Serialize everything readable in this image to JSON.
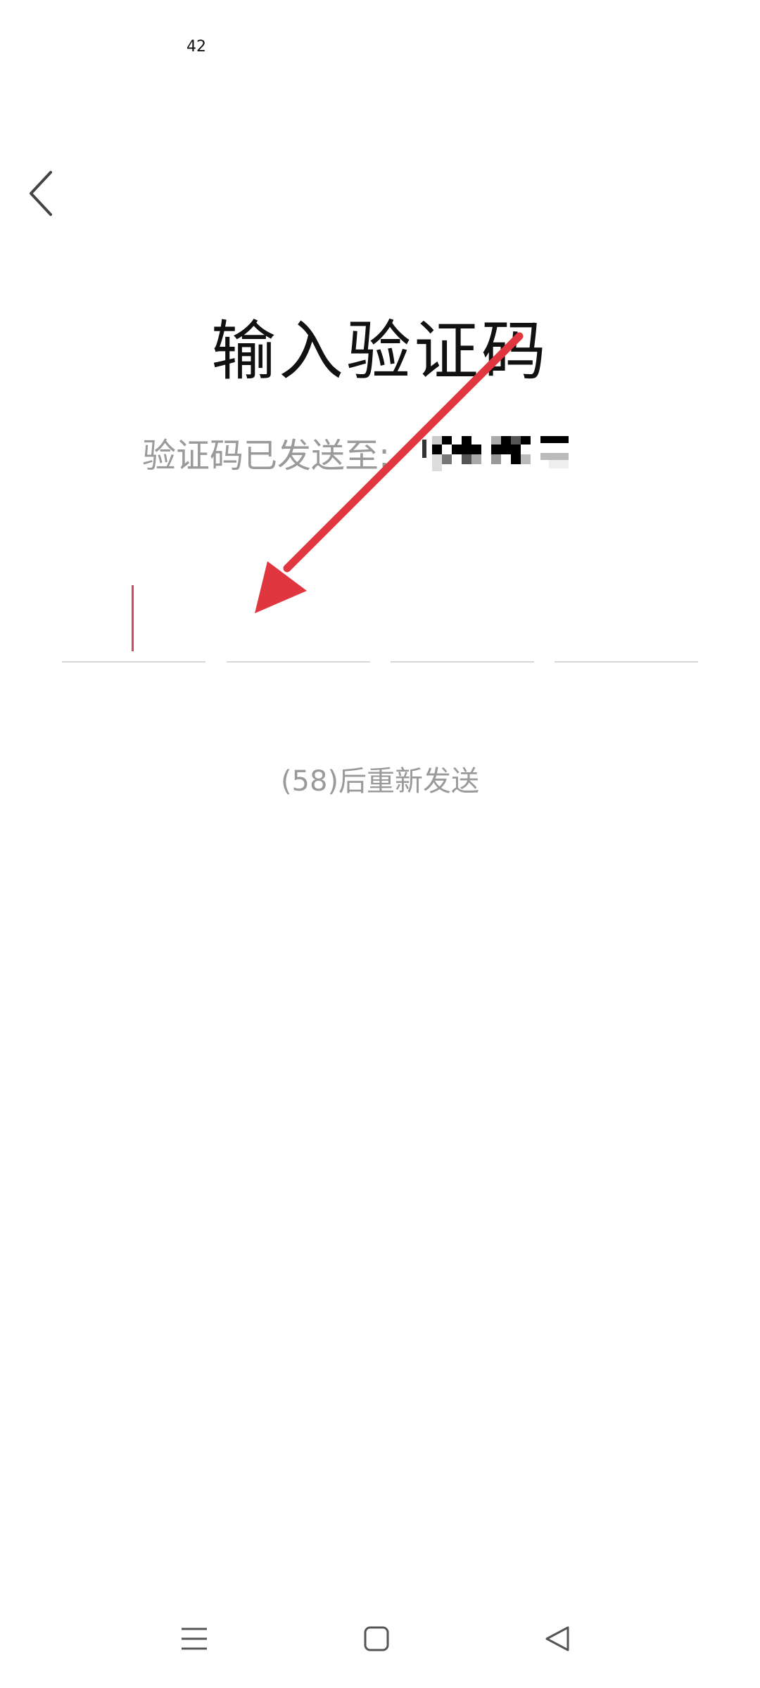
{
  "status_bar": {
    "time_fragment": "42"
  },
  "header": {
    "back_icon": "chevron-left-icon"
  },
  "main": {
    "title": "输入验证码",
    "sent_to_label": "验证码已发送至:",
    "code_slots": [
      "",
      "",
      "",
      ""
    ],
    "resend_text": "(58)后重新发送"
  },
  "nav_bar": {
    "icons": [
      "menu-icon",
      "home-icon",
      "back-triangle-icon"
    ]
  },
  "colors": {
    "cursor": "#d24a58",
    "arrow": "#e0363f",
    "muted_text": "#9a9a9a"
  }
}
